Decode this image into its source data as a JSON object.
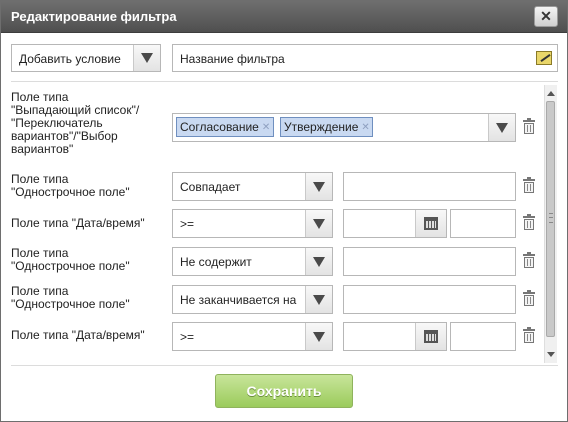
{
  "dialog": {
    "title": "Редактирование фильтра",
    "close_symbol": "✕"
  },
  "toolbar": {
    "add_condition": "Добавить условие",
    "filter_name": "Название фильтра"
  },
  "rows": [
    {
      "label": "Поле типа\n\"Выпадающий список\"/\n\"Переключатель\nвариантов\"/\"Выбор\nвариантов\"",
      "tags": [
        "Согласование",
        "Утверждение"
      ]
    },
    {
      "label": "Поле типа\n\"Однострочное поле\"",
      "operator": "Совпадает",
      "value": ""
    },
    {
      "label": "Поле типа \"Дата/время\"",
      "operator": ">=",
      "value": "",
      "value2": ""
    },
    {
      "label": "Поле типа\n\"Однострочное поле\"",
      "operator": "Не содержит",
      "value": ""
    },
    {
      "label": "Поле типа\n\"Однострочное поле\"",
      "operator": "Не заканчивается на",
      "value": ""
    },
    {
      "label": "Поле типа \"Дата/время\"",
      "operator": ">=",
      "value": "",
      "value2": ""
    }
  ],
  "footer": {
    "save_label": "Сохранить"
  },
  "colors": {
    "titlebar": "#5f5f5f",
    "tag_bg": "#c9d9f1",
    "save_button": "#9bcb5c"
  },
  "icons": {
    "edit": "pencil-icon",
    "delete": "trash-icon",
    "calendar": "calendar-icon",
    "dropdown": "chevron-down-icon"
  }
}
